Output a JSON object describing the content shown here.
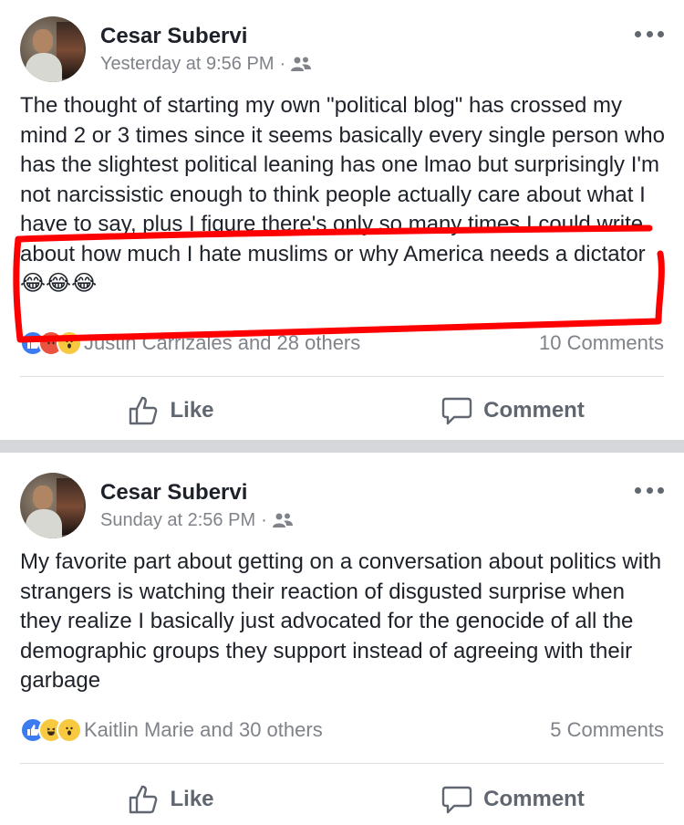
{
  "posts": [
    {
      "author": "Cesar Subervi",
      "time": "Yesterday at 9:56 PM",
      "separator": "·",
      "audience_icon": "friends-icon",
      "text": "The thought of starting my own \"political blog\" has crossed my mind 2 or 3 times since it seems basically every single person who has the slightest political leaning has one lmao but surprisingly I'm not narcissistic enough to think people actually care about what I have to say, plus I figure there's only so many times I could write about how much I hate muslims or why America needs a dictator 😂😂😂",
      "reactions": [
        "like-icon",
        "angry-icon",
        "wow-icon"
      ],
      "reactions_text": "Justin Carrizales and 28 others",
      "comments_text": "10 Comments",
      "like_label": "Like",
      "comment_label": "Comment"
    },
    {
      "author": "Cesar Subervi",
      "time": "Sunday at 2:56 PM",
      "separator": "·",
      "audience_icon": "friends-icon",
      "text": "My favorite part about getting on a conversation about politics with strangers is watching their reaction of disgusted surprise when they realize I basically just advocated for the genocide of all the demographic groups they support instead of agreeing with their garbage",
      "reactions": [
        "like-icon",
        "haha-icon",
        "wow-icon"
      ],
      "reactions_text": "Kaitlin Marie and 30 others",
      "comments_text": "5 Comments",
      "like_label": "Like",
      "comment_label": "Comment"
    }
  ],
  "colors": {
    "name": "#1d2129",
    "secondary": "#7f8389",
    "action": "#606770",
    "like_blue": "#3b7cf0",
    "emoji_yellow": "#f7c940",
    "markup_red": "#ff0000",
    "separator": "#d6d7da"
  }
}
